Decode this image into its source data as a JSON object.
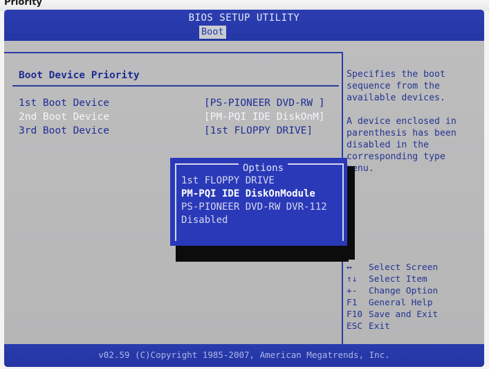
{
  "caption": "Priority",
  "app": {
    "title": "BIOS SETUP UTILITY",
    "active_tab": "Boot"
  },
  "section": {
    "title": "Boot Device Priority"
  },
  "boot_devices": [
    {
      "label": "1st Boot Device",
      "value": "[PS-PIONEER DVD-RW ]"
    },
    {
      "label": "2nd Boot Device",
      "value": "[PM-PQI IDE DiskOnM]"
    },
    {
      "label": "3rd Boot Device",
      "value": "[1st FLOPPY DRIVE]"
    }
  ],
  "options_popup": {
    "title": "Options",
    "items": [
      "1st FLOPPY DRIVE",
      "PM-PQI IDE DiskOnModule",
      "PS-PIONEER DVD-RW DVR-112",
      "Disabled"
    ],
    "highlighted_index": 1
  },
  "help": {
    "text": "Specifies the boot sequence from the available devices.",
    "text2": "A device enclosed in parenthesis has been disabled in the corresponding type menu.",
    "keys": [
      {
        "key": "↔",
        "action": "Select Screen"
      },
      {
        "key": "↑↓",
        "action": "Select Item"
      },
      {
        "key": "+-",
        "action": "Change Option"
      },
      {
        "key": "F1",
        "action": "General Help"
      },
      {
        "key": "F10",
        "action": "Save and Exit"
      },
      {
        "key": "ESC",
        "action": "Exit"
      }
    ]
  },
  "footer": {
    "text": "v02.59 (C)Copyright 1985-2007, American Megatrends, Inc."
  },
  "colors": {
    "bios_blue": "#2a39b8",
    "background_gray": "#bcbcbd",
    "text_blue": "#1f2d93"
  }
}
